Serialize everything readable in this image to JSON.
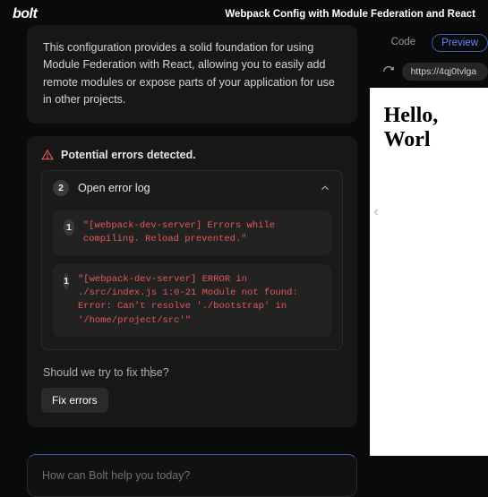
{
  "header": {
    "logo": "bolt",
    "title": "Webpack Config with Module Federation and React"
  },
  "description": "This configuration provides a solid foundation for using Module Federation with React, allowing you to easily add remote modules or expose parts of your application for use in other projects.",
  "errors": {
    "heading": "Potential errors detected.",
    "log_label": "Open error log",
    "count": "2",
    "items": [
      {
        "count": "1",
        "text": "\"[webpack-dev-server] Errors while compiling. Reload prevented.\""
      },
      {
        "count": "1",
        "text": "\"[webpack-dev-server] ERROR in ./src/index.js 1:0-21 Module not found: Error: Can't resolve './bootstrap' in '/home/project/src'\""
      }
    ],
    "prompt_before": "Should we try to fix th",
    "prompt_after": "se?",
    "fix_label": "Fix errors"
  },
  "chat": {
    "placeholder": "How can Bolt help you today?"
  },
  "preview": {
    "tabs": {
      "code": "Code",
      "preview": "Preview"
    },
    "url": "https://4qj0tvlga",
    "page_heading": "Hello, Worl"
  }
}
